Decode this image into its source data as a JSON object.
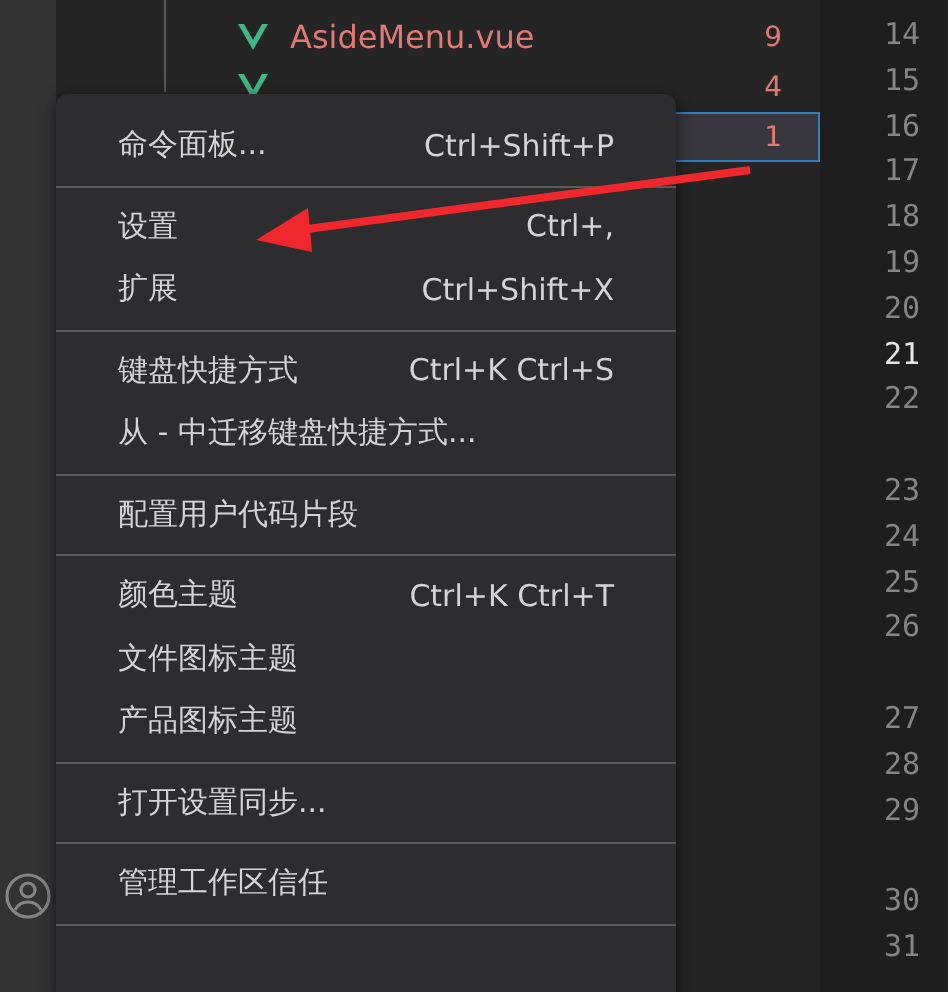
{
  "explorer": {
    "files": [
      {
        "kind": "vue",
        "name": "AsideMenu.vue",
        "badge": "9",
        "selected": false
      },
      {
        "kind": "vue",
        "badge": "4",
        "selected": false
      },
      {
        "kind": "hidden",
        "badge": "1",
        "selected": true
      }
    ]
  },
  "gutter": {
    "lines": [
      {
        "number": "14",
        "current": false,
        "wraps": false
      },
      {
        "number": "15",
        "current": false,
        "wraps": false
      },
      {
        "number": "16",
        "current": false,
        "wraps": false
      },
      {
        "number": "17",
        "current": false,
        "wraps": false
      },
      {
        "number": "18",
        "current": false,
        "wraps": false
      },
      {
        "number": "19",
        "current": false,
        "wraps": false
      },
      {
        "number": "20",
        "current": false,
        "wraps": false
      },
      {
        "number": "21",
        "current": true,
        "wraps": false
      },
      {
        "number": "22",
        "current": false,
        "wraps": true
      },
      {
        "number": "23",
        "current": false,
        "wraps": false
      },
      {
        "number": "24",
        "current": false,
        "wraps": false
      },
      {
        "number": "25",
        "current": false,
        "wraps": false
      },
      {
        "number": "26",
        "current": false,
        "wraps": true
      },
      {
        "number": "27",
        "current": false,
        "wraps": false
      },
      {
        "number": "28",
        "current": false,
        "wraps": false
      },
      {
        "number": "29",
        "current": false,
        "wraps": true
      },
      {
        "number": "30",
        "current": false,
        "wraps": false
      },
      {
        "number": "31",
        "current": false,
        "wraps": false
      }
    ]
  },
  "menu": {
    "groups": [
      [
        {
          "label": "命令面板...",
          "shortcut": "Ctrl+Shift+P"
        }
      ],
      [
        {
          "label": "设置",
          "shortcut": "Ctrl+,"
        },
        {
          "label": "扩展",
          "shortcut": "Ctrl+Shift+X"
        }
      ],
      [
        {
          "label": "键盘快捷方式",
          "shortcut": "Ctrl+K Ctrl+S"
        },
        {
          "label": "从 - 中迁移键盘快捷方式..."
        }
      ],
      [
        {
          "label": "配置用户代码片段"
        }
      ],
      [
        {
          "label": "颜色主题",
          "shortcut": "Ctrl+K Ctrl+T"
        },
        {
          "label": "文件图标主题"
        },
        {
          "label": "产品图标主题"
        }
      ],
      [
        {
          "label": "打开设置同步..."
        }
      ],
      [
        {
          "label": "管理工作区信任"
        }
      ]
    ]
  }
}
